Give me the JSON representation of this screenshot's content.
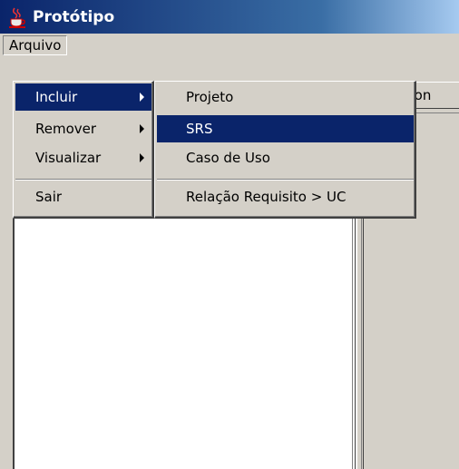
{
  "window": {
    "title": "Protótipo",
    "icon": "java-cup-icon"
  },
  "menubar": {
    "arquivo": "Arquivo"
  },
  "background": {
    "button_partial": "ecion"
  },
  "menu": {
    "items": [
      {
        "label": "Incluir",
        "submenu": true,
        "selected": true
      },
      {
        "label": "Remover",
        "submenu": true,
        "selected": false
      },
      {
        "label": "Visualizar",
        "submenu": true,
        "selected": false
      },
      {
        "label": "Sair",
        "submenu": false,
        "selected": false
      }
    ]
  },
  "submenu": {
    "items": [
      {
        "label": "Projeto",
        "selected": false
      },
      {
        "label": "SRS",
        "selected": true
      },
      {
        "label": "Caso de Uso",
        "selected": false
      },
      {
        "label": "Relação Requisito > UC",
        "selected": false
      }
    ]
  },
  "colors": {
    "selection": "#0a246a",
    "face": "#d4d0c8",
    "title_start": "#0a246a",
    "title_end": "#a6caf0"
  }
}
